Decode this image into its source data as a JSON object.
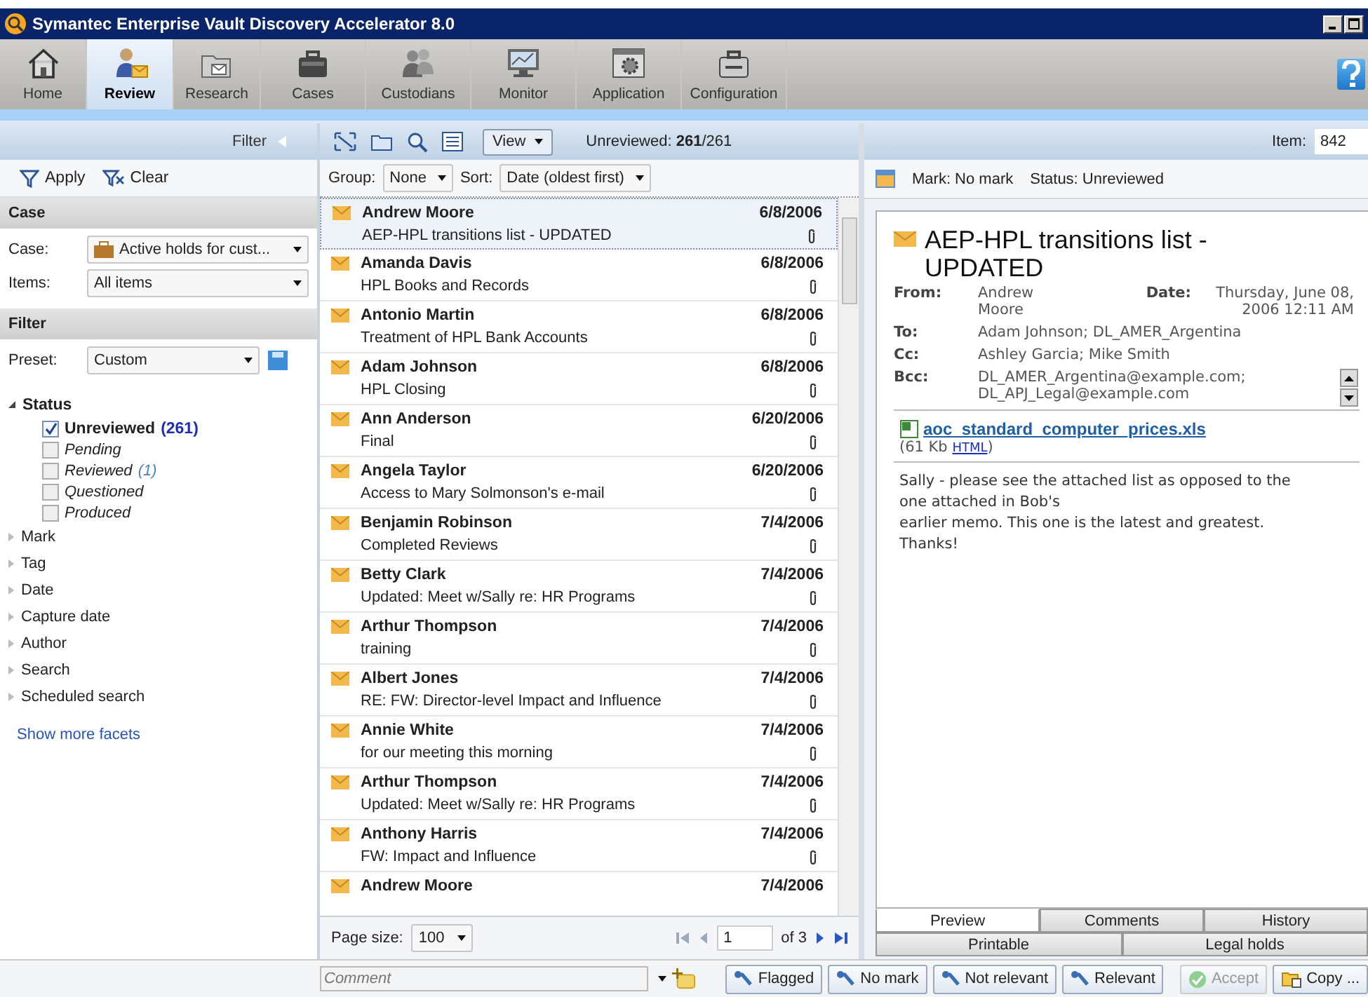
{
  "window": {
    "title": "Symantec Enterprise Vault Discovery Accelerator 8.0"
  },
  "nav_tabs": [
    {
      "label": "Home",
      "selected": false
    },
    {
      "label": "Review",
      "selected": true
    },
    {
      "label": "Research",
      "selected": false
    },
    {
      "label": "Cases",
      "selected": false
    },
    {
      "label": "Custodians",
      "selected": false
    },
    {
      "label": "Monitor",
      "selected": false
    },
    {
      "label": "Application",
      "selected": false
    },
    {
      "label": "Configuration",
      "selected": false
    }
  ],
  "filter_panel": {
    "title": "Filter",
    "apply": "Apply",
    "clear": "Clear",
    "case_section": {
      "title": "Case",
      "case_label": "Case:",
      "case_value": "Active holds for cust...",
      "items_label": "Items:",
      "items_value": "All items"
    },
    "filter_section": {
      "title": "Filter",
      "preset_label": "Preset:",
      "preset_value": "Custom"
    },
    "facets": [
      {
        "label": "Status",
        "expanded": true,
        "options": [
          {
            "label": "Unreviewed",
            "count": "(261)",
            "checked": true
          },
          {
            "label": "Pending",
            "checked": false
          },
          {
            "label": "Reviewed",
            "count": "(1)",
            "checked": false
          },
          {
            "label": "Questioned",
            "checked": false
          },
          {
            "label": "Produced",
            "checked": false
          }
        ]
      },
      {
        "label": "Mark",
        "expanded": false
      },
      {
        "label": "Tag",
        "expanded": false
      },
      {
        "label": "Date",
        "expanded": false
      },
      {
        "label": "Capture date",
        "expanded": false
      },
      {
        "label": "Author",
        "expanded": false
      },
      {
        "label": "Search",
        "expanded": false
      },
      {
        "label": "Scheduled search",
        "expanded": false
      }
    ],
    "more_link": "Show more facets"
  },
  "list_toolbar": {
    "view": "View",
    "unreviewed": "Unreviewed: **261**/261",
    "group_label": "Group:",
    "group_value": "None",
    "sort_label": "Sort:",
    "sort_value": "Date (oldest first)"
  },
  "messages": [
    {
      "sender": "Andrew Moore",
      "subject": "AEP-HPL transitions list - UPDATED",
      "date": "6/8/2006",
      "attachment": true,
      "selected": true
    },
    {
      "sender": "Amanda Davis",
      "subject": "HPL Books and Records",
      "date": "6/8/2006",
      "attachment": true,
      "selected": false
    },
    {
      "sender": "Antonio Martin",
      "subject": "Treatment of HPL Bank Accounts",
      "date": "6/8/2006",
      "attachment": true,
      "selected": false
    },
    {
      "sender": "Adam Johnson",
      "subject": "HPL Closing",
      "date": "6/8/2006",
      "attachment": true,
      "selected": false
    },
    {
      "sender": "Ann Anderson",
      "subject": "Final",
      "date": "6/20/2006",
      "attachment": true,
      "selected": false
    },
    {
      "sender": "Angela Taylor",
      "subject": "Access to Mary Solmonson's e-mail",
      "date": "6/20/2006",
      "attachment": true,
      "selected": false
    },
    {
      "sender": "Benjamin Robinson",
      "subject": "Completed Reviews",
      "date": "7/4/2006",
      "attachment": true,
      "selected": false
    },
    {
      "sender": "Betty Clark",
      "subject": "Updated: Meet w/Sally re: HR Programs",
      "date": "7/4/2006",
      "attachment": true,
      "selected": false
    },
    {
      "sender": "Arthur Thompson",
      "subject": "training",
      "date": "7/4/2006",
      "attachment": true,
      "selected": false
    },
    {
      "sender": "Albert Jones",
      "subject": "RE: FW: Director-level Impact and Influence",
      "date": "7/4/2006",
      "attachment": true,
      "selected": false
    },
    {
      "sender": "Annie White",
      "subject": "for our meeting this morning",
      "date": "7/4/2006",
      "attachment": true,
      "selected": false
    },
    {
      "sender": "Arthur Thompson",
      "subject": "Updated: Meet w/Sally re: HR Programs",
      "date": "7/4/2006",
      "attachment": true,
      "selected": false
    },
    {
      "sender": "Anthony Harris",
      "subject": "FW: Impact and Influence",
      "date": "7/4/2006",
      "attachment": true,
      "selected": false
    },
    {
      "sender": "Andrew Moore",
      "date": "7/4/2006",
      "attachment": false,
      "selected": false
    }
  ],
  "pagination": {
    "page_size_label": "Page size:",
    "page_size": "100",
    "page": "1",
    "of": "of 3"
  },
  "item": {
    "label": "Item:",
    "value": "842"
  },
  "preview": {
    "mark": "Mark: No mark",
    "status": "Status: Unreviewed",
    "subject": "AEP-HPL transitions list - UPDATED",
    "from_label": "From:",
    "from": "Andrew Moore",
    "date_label": "Date:",
    "date": "Thursday, June 08, 2006 12:11 AM",
    "to_label": "To:",
    "to": "Adam Johnson; DL_AMER_Argentina",
    "cc_label": "Cc:",
    "cc": "Ashley Garcia; Mike Smith",
    "bcc_label": "Bcc:",
    "bcc": "DL_AMER_Argentina@example.com; DL_APJ_Legal@example.com",
    "attachment_name": "aoc_standard_computer_prices.xls",
    "size_prefix": "(61 Kb",
    "html_link": "HTML",
    "size_suffix": ")",
    "body": "Sally - please see the attached list as opposed to the one attached in Bob's\nearlier memo.  This one is the latest and greatest.\nThanks!",
    "tabs_row_1": [
      {
        "label": "Preview",
        "selected": true
      },
      {
        "label": "Comments",
        "selected": false
      },
      {
        "label": "History",
        "selected": false
      }
    ],
    "tabs_row_2": [
      {
        "label": "Printable",
        "selected": false
      },
      {
        "label": "Legal holds",
        "selected": false
      }
    ]
  },
  "comment": {
    "placeholder": "Comment"
  },
  "actions": [
    {
      "label": "Flagged",
      "kind": "mark",
      "disabled": false
    },
    {
      "label": "No mark",
      "kind": "mark",
      "disabled": false
    },
    {
      "label": "Not relevant",
      "kind": "mark",
      "disabled": false
    },
    {
      "label": "Relevant",
      "kind": "mark",
      "disabled": false
    },
    {
      "label": "Accept",
      "kind": "accept",
      "disabled": true
    },
    {
      "label": "Copy ...",
      "kind": "copy",
      "disabled": false
    }
  ]
}
